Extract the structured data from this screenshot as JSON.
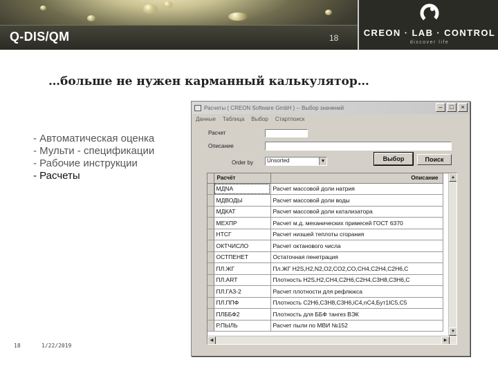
{
  "header": {
    "title": "Q-DIS/QM",
    "slide_number": "18",
    "logo_text": "CREON · LAB · CONTROL",
    "logo_tagline": "discover life"
  },
  "subtitle": "…больше не нужен карманный калькулятор…",
  "bullets": [
    "- Автоматическая оценка",
    "- Мульти - спецификации",
    "- Рабочие инструкции",
    "- Расчеты"
  ],
  "footer": {
    "page": "18",
    "date": "1/22/2019"
  },
  "window": {
    "title": "Расчеты ( CREON Software GmbH )  --  Выбор значений",
    "menu": [
      "Данные",
      "Таблица",
      "Выбор",
      "Стартпоиск"
    ],
    "fields": {
      "calc_label": "Расчет",
      "calc_value": "",
      "desc_label": "Описание",
      "desc_value": "",
      "order_label": "Order by",
      "order_value": "Unsorted"
    },
    "buttons": {
      "select": "Выбор",
      "search": "Поиск"
    },
    "table": {
      "columns": [
        "Расчёт",
        "Описание"
      ],
      "rows": [
        [
          "МДNA",
          "Расчет массовой доли натрия"
        ],
        [
          "МДВОДЫ",
          "Расчет массовой доли воды"
        ],
        [
          "МДКАТ",
          "Расчет массовой доли катализатора"
        ],
        [
          "МЕХПР",
          "Расчет м.д. механических примесей ГОСТ 6370"
        ],
        [
          "НТСГ",
          "Расчет низшей теплоты сгорания"
        ],
        [
          "ОКТЧИСЛО",
          "Расчет октанового числа"
        ],
        [
          "ОСТПЕНЕТ",
          "Остаточная пенетрация"
        ],
        [
          "ПЛ.ЖГ",
          "Пл.ЖГ H2S,H2,N2,O2,CO2,CO,CH4,C2H4,C2H6,C"
        ],
        [
          "ПЛ.ART",
          "Плотность H2S,H2,CH4,C2H6,C2H4,C3H8,C3H6,C"
        ],
        [
          "ПЛ.ГАЗ-2",
          "Расчет плотности для рефлюкса"
        ],
        [
          "ПЛ.ППФ",
          "Плотность C2H6,C3H8,C3H6,iC4,nC4,Бут1IC5,C5"
        ],
        [
          "ПЛББФ2",
          "Плотность для ББФ тангез ВЭК"
        ],
        [
          "Р.ПЫЛЬ",
          "Расчет пыли по МВИ №152"
        ]
      ]
    }
  }
}
